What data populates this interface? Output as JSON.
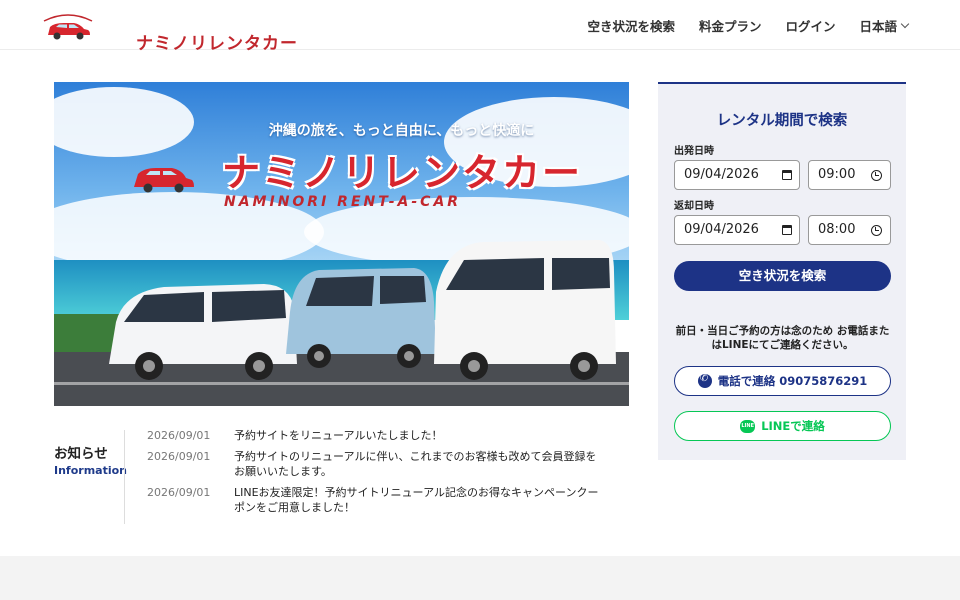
{
  "header": {
    "logo_alt": "Naminori Rent a Car",
    "logo_script": "Naminori Rent-a-Car",
    "logo_text": "ナミノリレンタカー",
    "nav": [
      {
        "label": "空き状況を検索"
      },
      {
        "label": "料金プラン"
      },
      {
        "label": "ログイン"
      },
      {
        "label": "日本語"
      }
    ]
  },
  "hero": {
    "tagline": "沖縄の旅を、もっと自由に、もっと快適に",
    "title": "ナミノリレンタカー",
    "subtitle": "NAMINORI RENT-A-CAR",
    "logo_script": "Naminori Rent-a-Car"
  },
  "news": {
    "title": "お知らせ",
    "subtitle": "Information",
    "items": [
      {
        "date": "2026/09/01",
        "text": "予約サイトをリニューアルいたしました！"
      },
      {
        "date": "2026/09/01",
        "text": "予約サイトのリニューアルに伴い、これまでのお客様も改めて会員登録をお願いいたします。"
      },
      {
        "date": "2026/09/01",
        "text": "LINEお友達限定！予約サイトリニューアル記念のお得なキャンペーンクーポンをご用意しました！"
      }
    ]
  },
  "search": {
    "title": "レンタル期間で検索",
    "departure_label": "出発日時",
    "departure_date": "09/04/2026",
    "departure_time": "09:00",
    "return_label": "返却日時",
    "return_date": "09/04/2026",
    "return_time": "08:00",
    "button": "空き状況を検索",
    "notice": "前日・当日ご予約の方は念のため お電話またはLINEにてご連絡ください。",
    "tel_button": "電話で連絡 09075876291",
    "line_button": "LINEで連絡",
    "line_icon_text": "LINE"
  },
  "colors": {
    "brand_red": "#d7262e",
    "navy": "#1d3386",
    "line_green": "#06c755"
  }
}
